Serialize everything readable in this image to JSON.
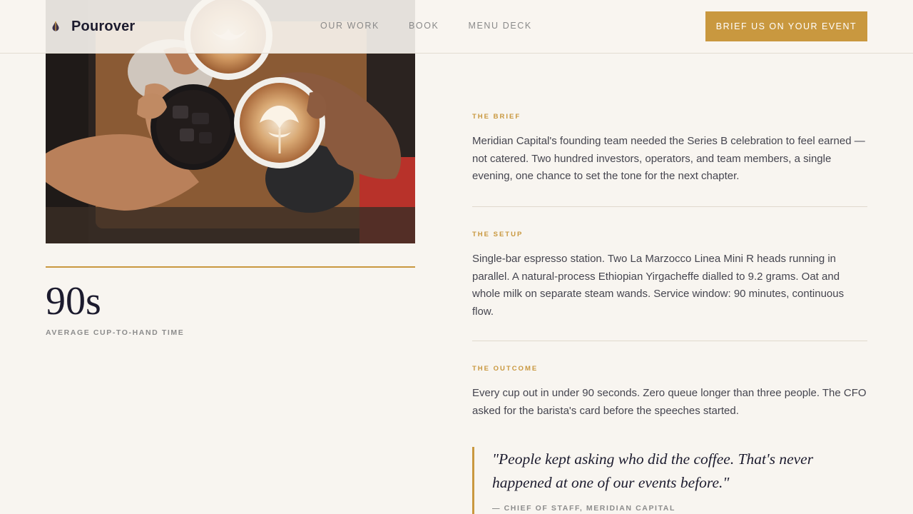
{
  "header": {
    "brand": "Pourover",
    "brand_icon": "coffee-drop-icon",
    "nav": [
      "OUR WORK",
      "BOOK",
      "MENU DECK"
    ],
    "cta": "BRIEF US ON YOUR EVENT"
  },
  "hero_image": {
    "icon": "photo-coffee-cups-toast"
  },
  "stat": {
    "value": "90s",
    "label": "AVERAGE CUP-TO-HAND TIME"
  },
  "sections": [
    {
      "kicker": "THE BRIEF",
      "text": "Meridian Capital's founding team needed the Series B celebration to feel earned — not catered. Two hundred investors, operators, and team members, a single evening, one chance to set the tone for the next chapter."
    },
    {
      "kicker": "THE SETUP",
      "text": "Single-bar espresso station. Two La Marzocco Linea Mini R heads running in parallel. A natural-process Ethiopian Yirgacheffe dialled to 9.2 grams. Oat and whole milk on separate steam wands. Service window: 90 minutes, continuous flow."
    },
    {
      "kicker": "THE OUTCOME",
      "text": "Every cup out in under 90 seconds. Zero queue longer than three people. The CFO asked for the barista's card before the speeches started."
    }
  ],
  "quote": {
    "text": "\"People kept asking who did the coffee. That's never happened at one of our events before.\"",
    "attribution": "— CHIEF OF STAFF, MERIDIAN CAPITAL"
  },
  "colors": {
    "accent": "#c9983f",
    "background": "#f8f5f0",
    "ink": "#1c1b2e"
  }
}
